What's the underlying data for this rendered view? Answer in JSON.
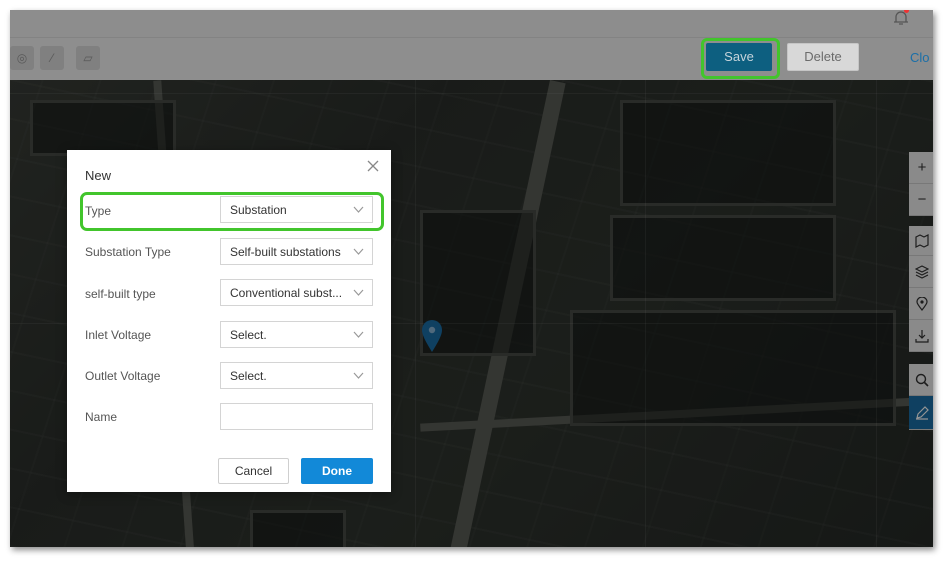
{
  "toolbar": {
    "save_label": "Save",
    "delete_label": "Delete",
    "close_label": "Clo"
  },
  "map_controls": {
    "zoom_in": "+",
    "zoom_out": "−"
  },
  "dialog": {
    "title": "New",
    "rows": [
      {
        "label": "Type",
        "value": "Substation"
      },
      {
        "label": "Substation Type",
        "value": "Self-built substations"
      },
      {
        "label": "self-built type",
        "value": "Conventional subst..."
      },
      {
        "label": "Inlet Voltage",
        "value": "Select."
      },
      {
        "label": "Outlet Voltage",
        "value": "Select."
      },
      {
        "label": "Name",
        "value": ""
      }
    ],
    "cancel_label": "Cancel",
    "done_label": "Done"
  },
  "colors": {
    "highlight": "#42c52c",
    "primary": "#1289d8",
    "save_bg": "#0d5f80"
  },
  "icons": [
    "bell-icon",
    "close-icon",
    "chevron-down-icon",
    "map-pin-icon",
    "layers-icon",
    "map-icon",
    "location-icon",
    "download-icon",
    "search-icon",
    "edit-icon"
  ]
}
